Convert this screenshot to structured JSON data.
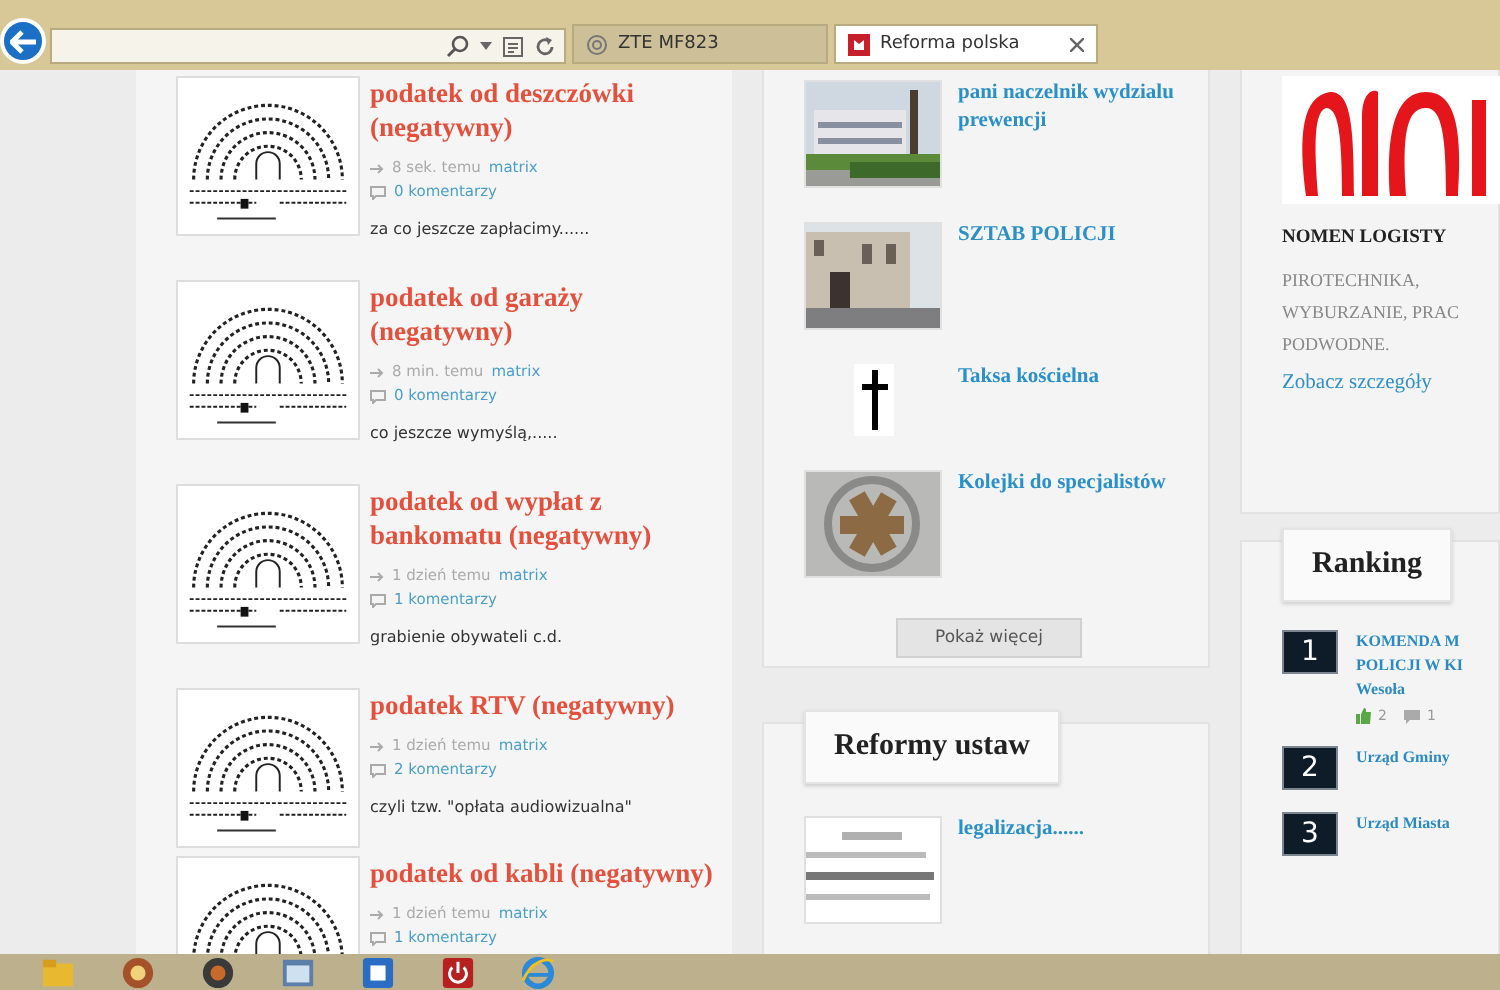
{
  "browser": {
    "tabs": [
      {
        "label": "ZTE MF823",
        "selected": false
      },
      {
        "label": "Reforma polska",
        "selected": true
      }
    ]
  },
  "articles": [
    {
      "title": "podatek od deszczówki (negatywny)",
      "time": "8 sek. temu",
      "author": "matrix",
      "comments": "0 komentarzy",
      "excerpt": "za co jeszcze zapłacimy......"
    },
    {
      "title": "podatek od garaży (negatywny)",
      "time": "8 min. temu",
      "author": "matrix",
      "comments": "0 komentarzy",
      "excerpt": "co jeszcze wymyślą,....."
    },
    {
      "title": "podatek od wypłat z bankomatu (negatywny)",
      "time": "1 dzień temu",
      "author": "matrix",
      "comments": "1 komentarzy",
      "excerpt": "grabienie obywateli c.d."
    },
    {
      "title": "podatek RTV (negatywny)",
      "time": "1 dzień temu",
      "author": "matrix",
      "comments": "2 komentarzy",
      "excerpt": "czyli tzw. \"opłata audiowizualna\""
    },
    {
      "title": "podatek od kabli (negatywny)",
      "time": "1 dzień temu",
      "author": "matrix",
      "comments": "1 komentarzy"
    }
  ],
  "middle": {
    "items": [
      {
        "title": "pani naczelnik wydzialu prewencji"
      },
      {
        "title": "SZTAB POLICJI"
      },
      {
        "title": "Taksa kościelna"
      },
      {
        "title": "Kolejki do specjalistów"
      }
    ],
    "more_button": "Pokaż więcej"
  },
  "reforms": {
    "heading": "Reformy ustaw",
    "items": [
      {
        "title": "legalizacja......"
      }
    ]
  },
  "sponsor": {
    "name": "NOMEN LOGISTY",
    "description_lines": [
      "PIROTECHNIKA,",
      "WYBURZANIE, PRAC",
      "PODWODNE."
    ],
    "link": "Zobacz szczegóły"
  },
  "ranking": {
    "heading": "Ranking",
    "items": [
      {
        "rank": "1",
        "title_lines": [
          "KOMENDA M",
          "POLICJI W KI",
          "Wesoła"
        ],
        "likes": "2",
        "comments": "1"
      },
      {
        "rank": "2",
        "title_lines": [
          "Urząd Gminy"
        ]
      },
      {
        "rank": "3",
        "title_lines": [
          "Urząd Miasta"
        ]
      }
    ]
  }
}
